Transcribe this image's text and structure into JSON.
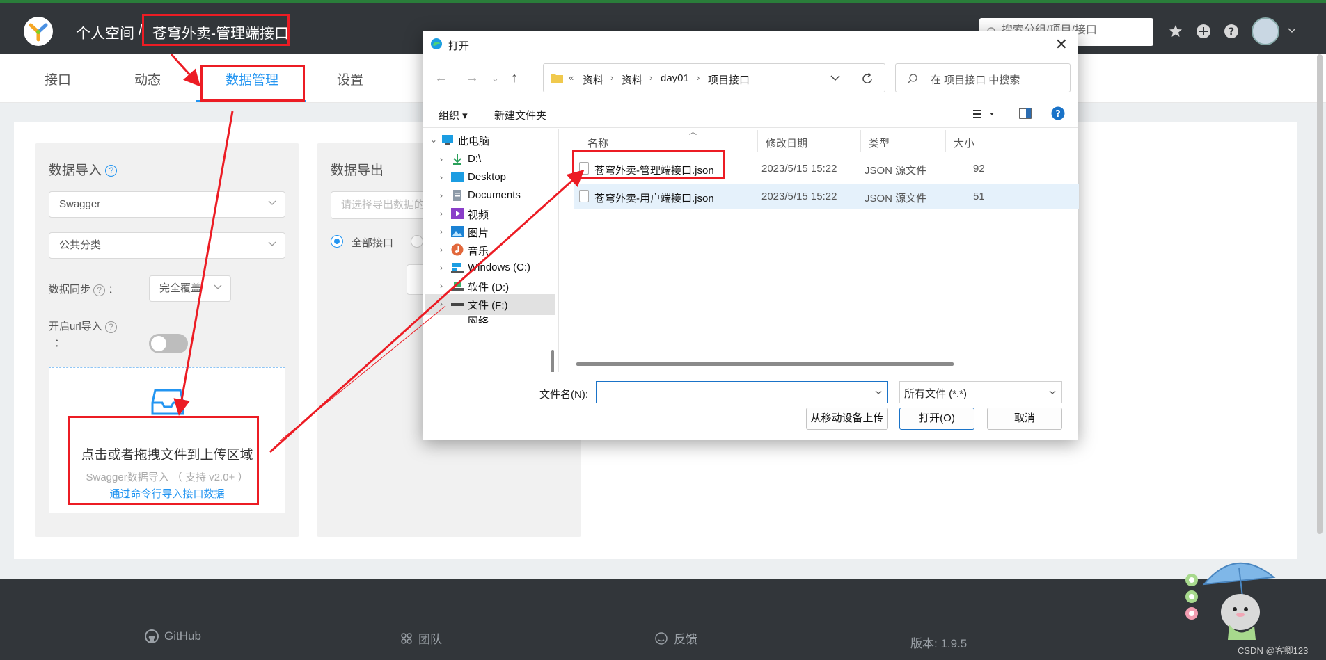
{
  "topbar": {
    "crumb_personal": "个人空间",
    "crumb_separator": "/",
    "crumb_project": "苍穹外卖-管理端接口",
    "search_placeholder": "搜索分组/项目/接口"
  },
  "tabs": [
    {
      "label": "接口"
    },
    {
      "label": "动态"
    },
    {
      "label": "数据管理",
      "active": true
    },
    {
      "label": "设置"
    }
  ],
  "import_panel": {
    "title": "数据导入",
    "format_value": "Swagger",
    "category_value": "公共分类",
    "sync_label": "数据同步",
    "sync_colon": "：",
    "sync_value": "完全覆盖",
    "url_label": "开启url导入",
    "url_colon": "：",
    "url_enabled": false,
    "drop_main": "点击或者拖拽文件到上传区域",
    "drop_sub": "Swagger数据导入 （ 支持 v2.0+ ）",
    "drop_link": "通过命令行导入接口数据"
  },
  "export_panel": {
    "title": "数据导出",
    "placeholder": "请选择导出数据的方式",
    "radio_all": "全部接口"
  },
  "footer": {
    "github": "GitHub",
    "team": "团队",
    "feedback": "反馈",
    "version": "版本: 1.9.5",
    "watermark": "CSDN @客卿123"
  },
  "dialog": {
    "title": "打开",
    "address": [
      "资料",
      "资料",
      "day01",
      "项目接口"
    ],
    "address_prefix": "«",
    "search_placeholder": "在 项目接口 中搜索",
    "toolbar_organize": "组织 ▾",
    "toolbar_new_folder": "新建文件夹",
    "tree": [
      {
        "label": "此电脑",
        "icon": "pc-icon"
      },
      {
        "label": "D:\\",
        "icon": "download-icon"
      },
      {
        "label": "Desktop",
        "icon": "desktop-icon"
      },
      {
        "label": "Documents",
        "icon": "documents-icon"
      },
      {
        "label": "视频",
        "icon": "video-icon"
      },
      {
        "label": "图片",
        "icon": "pictures-icon"
      },
      {
        "label": "音乐",
        "icon": "music-icon"
      },
      {
        "label": "Windows (C:)",
        "icon": "drive-icon"
      },
      {
        "label": "软件 (D:)",
        "icon": "drive-icon"
      },
      {
        "label": "文件 (F:)",
        "icon": "drive-icon",
        "selected": true
      },
      {
        "label": "网络",
        "icon": "network-icon"
      }
    ],
    "columns": [
      "名称",
      "修改日期",
      "类型",
      "大小"
    ],
    "files": [
      {
        "name": "苍穹外卖-管理端接口.json",
        "date": "2023/5/15 15:22",
        "type": "JSON 源文件",
        "size": "92"
      },
      {
        "name": "苍穹外卖-用户端接口.json",
        "date": "2023/5/15 15:22",
        "type": "JSON 源文件",
        "size": "51",
        "selected": true
      }
    ],
    "filename_label": "文件名(N):",
    "filename_value": "",
    "filetype_value": "所有文件 (*.*)",
    "btn_mobile": "从移动设备上传",
    "btn_open": "打开(O)",
    "btn_cancel": "取消"
  },
  "colors": {
    "accent": "#2395f1",
    "annotation_red": "#ec1c24",
    "topbar": "#32363a"
  }
}
